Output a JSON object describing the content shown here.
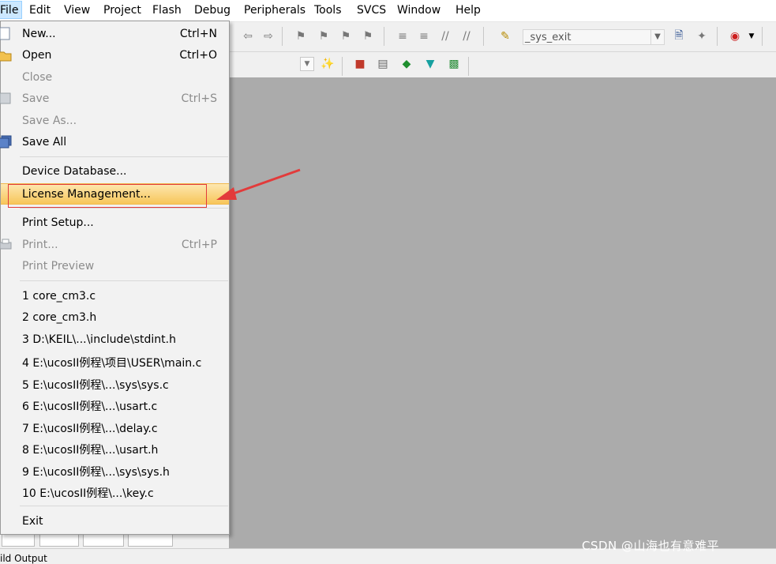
{
  "menubar": {
    "items": [
      "File",
      "Edit",
      "View",
      "Project",
      "Flash",
      "Debug",
      "Peripherals",
      "Tools",
      "SVCS",
      "Window",
      "Help"
    ]
  },
  "toolbar": {
    "function_combo": "_sys_exit"
  },
  "file_menu": {
    "new": {
      "label": "New...",
      "shortcut": "Ctrl+N"
    },
    "open": {
      "label": "Open",
      "shortcut": "Ctrl+O"
    },
    "close": {
      "label": "Close"
    },
    "save": {
      "label": "Save",
      "shortcut": "Ctrl+S"
    },
    "save_as": {
      "label": "Save As..."
    },
    "save_all": {
      "label": "Save All"
    },
    "device_database": {
      "label": "Device Database..."
    },
    "license_management": {
      "label": "License Management..."
    },
    "print_setup": {
      "label": "Print Setup..."
    },
    "print": {
      "label": "Print...",
      "shortcut": "Ctrl+P"
    },
    "print_preview": {
      "label": "Print Preview"
    },
    "recent": [
      "1 core_cm3.c",
      "2 core_cm3.h",
      "3 D:\\KEIL\\...\\include\\stdint.h",
      "4 E:\\ucosII例程\\项目\\USER\\main.c",
      "5 E:\\ucosII例程\\...\\sys\\sys.c",
      "6 E:\\ucosII例程\\...\\usart.c",
      "7 E:\\ucosII例程\\...\\delay.c",
      "8 E:\\ucosII例程\\...\\usart.h",
      "9 E:\\ucosII例程\\...\\sys\\sys.h",
      "10 E:\\ucosII例程\\...\\key.c"
    ],
    "exit": {
      "label": "Exit"
    }
  },
  "status": {
    "build_output": "ild Output"
  },
  "watermark": "CSDN @山海也有意难平",
  "colors": {
    "highlight_start": "#fde7b0",
    "highlight_end": "#f7c65a",
    "annotation_red": "#e23b3b",
    "workspace": "#ababab"
  }
}
